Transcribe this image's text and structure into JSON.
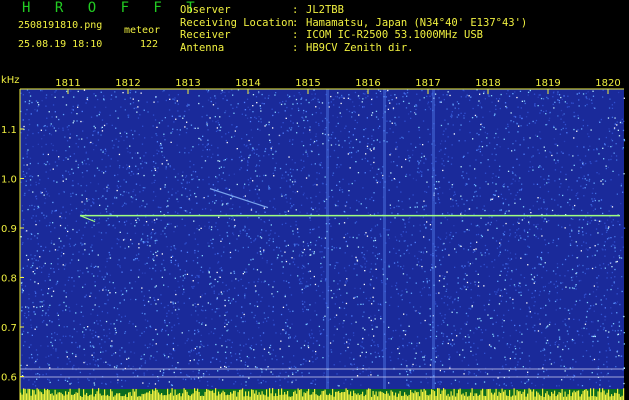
{
  "header": {
    "title": "H R O F F T",
    "filename": "2508191810.png",
    "datetime": "25.08.19 18:10",
    "meteor_label": "meteor",
    "meteor_count": "122"
  },
  "info": [
    {
      "key": "Observer",
      "colon": ":",
      "value": "JL2TBB"
    },
    {
      "key": "Receiving Location",
      "colon": ":",
      "value": "Hamamatsu, Japan (N34°40' E137°43')"
    },
    {
      "key": "Receiver",
      "colon": ":",
      "value": "ICOM IC-R2500 53.1000MHz USB"
    },
    {
      "key": "Antenna",
      "colon": ":",
      "value": "HB9CV Zenith dir."
    }
  ],
  "spectrogram": {
    "y_unit": "kHz",
    "x_ticks": [
      "1811",
      "1812",
      "1813",
      "1814",
      "1815",
      "1816",
      "1817",
      "1818",
      "1819",
      "1820"
    ],
    "y_ticks": [
      "1.1",
      "1.0",
      "0.9",
      "0.8",
      "0.7",
      "0.6"
    ],
    "carrier_khz": 0.925,
    "colors": {
      "background": "#1a2a9a",
      "signal": "#a0ff80",
      "text": "#f0f040",
      "baseline": "#f0f040"
    }
  }
}
